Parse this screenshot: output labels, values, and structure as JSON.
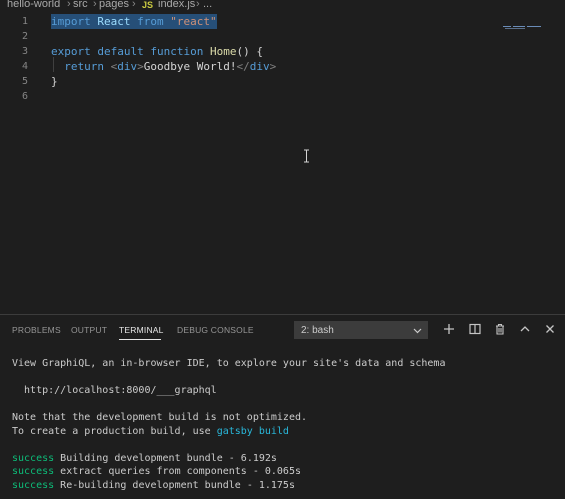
{
  "breadcrumb": {
    "items": [
      "hello-world",
      "src",
      "pages",
      "index.js",
      "..."
    ],
    "file_icon": "JS"
  },
  "editor": {
    "line_numbers": [
      "1",
      "2",
      "3",
      "4",
      "5",
      "6"
    ],
    "lines": [
      {
        "tokens": [
          {
            "t": "import",
            "c": "kw"
          },
          {
            "t": " React ",
            "c": "id"
          },
          {
            "t": "from",
            "c": "kw"
          },
          {
            "t": " ",
            "c": ""
          },
          {
            "t": "\"react\"",
            "c": "str"
          }
        ]
      },
      {
        "tokens": []
      },
      {
        "tokens": [
          {
            "t": "export",
            "c": "kw"
          },
          {
            "t": " ",
            "c": ""
          },
          {
            "t": "default",
            "c": "kw"
          },
          {
            "t": " ",
            "c": ""
          },
          {
            "t": "function",
            "c": "kw"
          },
          {
            "t": " ",
            "c": ""
          },
          {
            "t": "Home",
            "c": "fn"
          },
          {
            "t": "() {",
            "c": ""
          }
        ]
      },
      {
        "tokens": [
          {
            "t": "  return ",
            "c": "kw"
          },
          {
            "t": "<",
            "c": "tag"
          },
          {
            "t": "div",
            "c": "tagname"
          },
          {
            "t": ">",
            "c": "tag"
          },
          {
            "t": "Goodbye World!",
            "c": ""
          },
          {
            "t": "</",
            "c": "tag"
          },
          {
            "t": "div",
            "c": "tagname"
          },
          {
            "t": ">",
            "c": "tag"
          }
        ]
      },
      {
        "tokens": [
          {
            "t": "}",
            "c": ""
          }
        ]
      },
      {
        "tokens": []
      }
    ],
    "selected_line": 1
  },
  "panel": {
    "tabs": [
      "PROBLEMS",
      "OUTPUT",
      "TERMINAL",
      "DEBUG CONSOLE"
    ],
    "active_tab": "TERMINAL",
    "terminal_select": "2: bash"
  },
  "terminal": {
    "lines": [
      {
        "parts": [
          {
            "t": "View GraphiQL, an in-browser IDE, to explore your site's data and schema",
            "c": ""
          }
        ]
      },
      {
        "parts": []
      },
      {
        "parts": [
          {
            "t": "  http://localhost:8000/___graphql",
            "c": ""
          }
        ]
      },
      {
        "parts": []
      },
      {
        "parts": [
          {
            "t": "Note that the development build is not optimized.",
            "c": ""
          }
        ]
      },
      {
        "parts": [
          {
            "t": "To create a production build, use ",
            "c": ""
          },
          {
            "t": "gatsby build",
            "c": "cyan"
          }
        ]
      },
      {
        "parts": []
      },
      {
        "parts": [
          {
            "t": "success",
            "c": "green"
          },
          {
            "t": " Building development bundle - 6.192s",
            "c": ""
          }
        ]
      },
      {
        "parts": [
          {
            "t": "success",
            "c": "green"
          },
          {
            "t": " extract queries from components - 0.065s",
            "c": ""
          }
        ]
      },
      {
        "parts": [
          {
            "t": "success",
            "c": "green"
          },
          {
            "t": " Re-building development bundle - 1.175s",
            "c": ""
          }
        ]
      }
    ]
  },
  "colors": {
    "background": "#1e1e1e",
    "keyword": "#569cd6",
    "string": "#ce9178",
    "function": "#dcdcaa",
    "success": "#0dbc79",
    "link": "#29b8db",
    "selection": "#264f78"
  }
}
